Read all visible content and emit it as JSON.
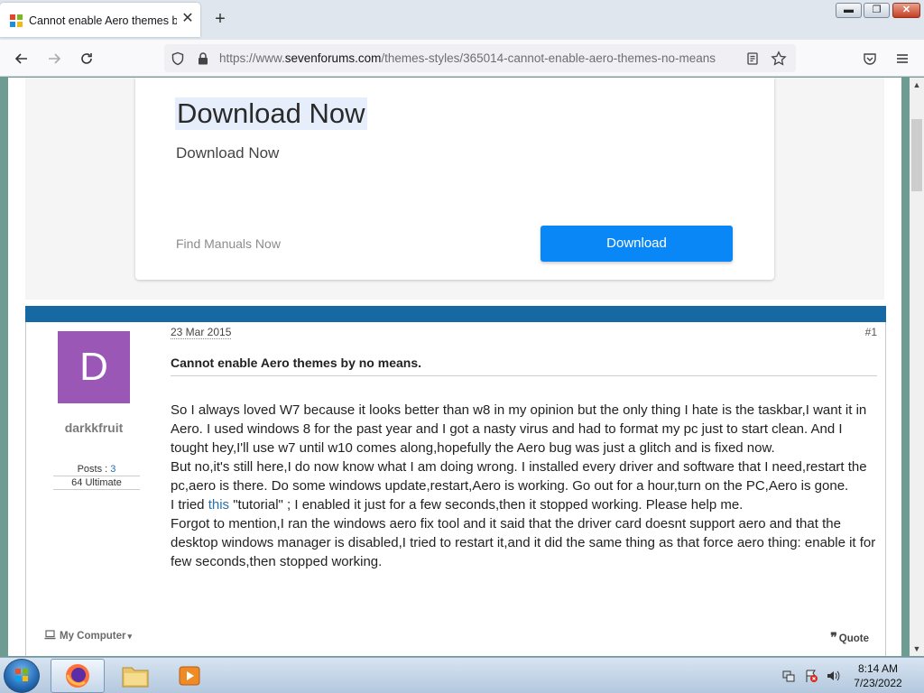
{
  "browser": {
    "tab_title": "Cannot enable Aero themes by no means",
    "url_prefix": "https://www.",
    "url_host": "sevenforums.com",
    "url_path": "/themes-styles/365014-cannot-enable-aero-themes-no-means"
  },
  "ad": {
    "headline": "Download Now",
    "subheadline": "Download Now",
    "manuals_text": "Find Manuals Now",
    "button_label": "Download"
  },
  "post": {
    "date": "23 Mar 2015",
    "number": "#1",
    "avatar_letter": "D",
    "avatar_color": "#9a57b5",
    "username": "darkkfruit",
    "posts_label": "Posts : ",
    "posts_count": "3",
    "os": "64 Ultimate",
    "title": "Cannot enable Aero themes by no means.",
    "paragraphs": [
      "So I always loved W7 because it looks better than w8 in my opinion but the only thing I hate is the taskbar,I want it in Aero. I used windows 8 for the past year and I got a nasty virus and had to format my pc just to start clean. And I tought hey,I'll use w7 until w10 comes along,hopefully the Aero bug was just a glitch and is fixed now.",
      "But no,it's still here,I do now know what I am doing wrong. I installed every driver and software that I need,restart the pc,aero is there. Do some windows update,restart,Aero is working. Go out for a hour,turn on the PC,Aero is gone."
    ],
    "tutorial_before": "I tried ",
    "tutorial_link": "this",
    "tutorial_after": " \"tutorial\" ; I enabled it just for a few seconds,then it stopped working. Please help me.",
    "paragraph_last": "Forgot to mention,I ran the windows aero fix tool and it said that the driver card doesnt support aero and that the desktop windows manager is disabled,I tried to restart it,and it did the same thing as that force aero thing: enable it for few seconds,then stopped working.",
    "my_computer": "My Computer",
    "quote": "Quote"
  },
  "taskbar": {
    "time": "8:14 AM",
    "date": "7/23/2022"
  },
  "colors": {
    "accent_blue": "#1769a4",
    "ad_button": "#0a87f6",
    "page_side": "#6e9c93"
  }
}
